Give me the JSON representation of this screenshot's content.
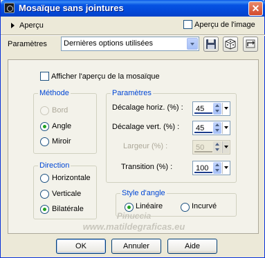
{
  "window": {
    "title": "Mosaïque sans jointures",
    "close_glyph": "✕"
  },
  "top": {
    "preview_toggle": "Aperçu",
    "image_preview_checkbox": "Aperçu de l'image",
    "params_label": "Paramètres",
    "preset_value": "Dernières options utilisées"
  },
  "panel": {
    "mosaic_preview_checkbox": "Afficher l'aperçu de la mosaïque",
    "method": {
      "label": "Méthode",
      "options": [
        "Bord",
        "Angle",
        "Miroir"
      ],
      "selected": "Angle"
    },
    "direction": {
      "label": "Direction",
      "options": [
        "Horizontale",
        "Verticale",
        "Bilatérale"
      ],
      "selected": "Bilatérale"
    },
    "params": {
      "label": "Paramètres",
      "h_offset_label": "Décalage horiz. (%) :",
      "h_offset_value": "45",
      "v_offset_label": "Décalage vert. (%) :",
      "v_offset_value": "45",
      "width_label": "Largeur (%) :",
      "width_value": "50",
      "transition_label": "Transition (%) :",
      "transition_value": "100"
    },
    "corner_style": {
      "label": "Style d'angle",
      "options": [
        "Linéaire",
        "Incurvé"
      ],
      "selected": "Linéaire"
    },
    "watermark_1": "Pinuccia",
    "watermark_2": "www.matildegraficas.eu"
  },
  "buttons": {
    "ok": "OK",
    "cancel": "Annuler",
    "help": "Aide"
  },
  "colors": {
    "titlebar": "#0553e3",
    "group_label": "#0046d5",
    "radio_dot": "#21a121"
  }
}
